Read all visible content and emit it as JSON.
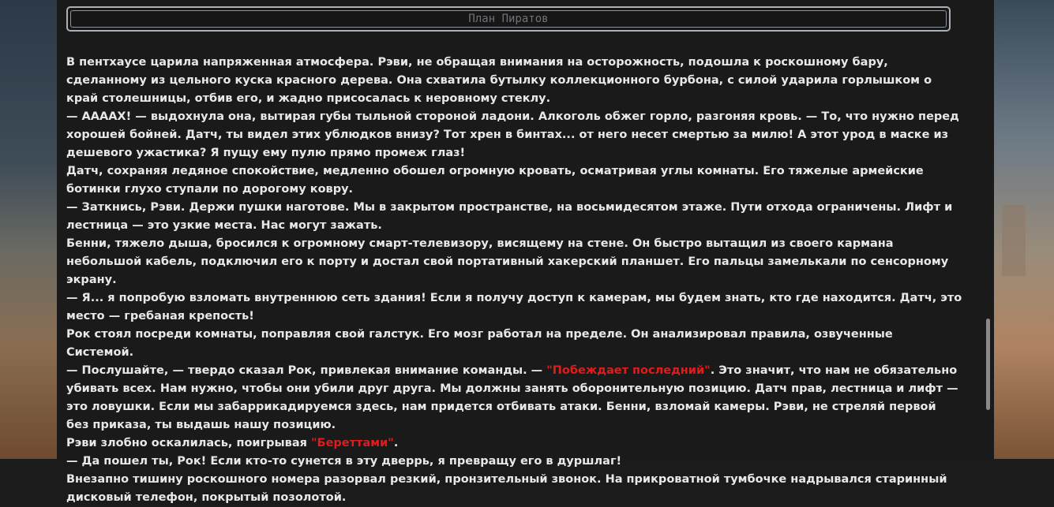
{
  "title": "План Пиратов",
  "paragraphs": [
    {
      "segments": [
        {
          "text": "В пентхаусе царила напряженная атмосфера. Рэви, не обращая внимания на осторожность, подошла к роскошному бару, сделанному из цельного куска красного дерева. Она схватила бутылку коллекционного бурбона, с силой ударила горлышком о край столешницы, отбив его, и жадно присосалась к неровному стеклу.",
          "hl": false
        }
      ]
    },
    {
      "segments": [
        {
          "text": "— ААААХ! — выдохнула она, вытирая губы тыльной стороной ладони. Алкоголь обжег горло, разгоняя кровь. — То, что нужно перед хорошей бойней. Датч, ты видел этих ублюдков внизу? Тот хрен в бинтах... от него несет смертью за милю! А этот урод в маске из дешевого ужастика? Я пущу ему пулю прямо промеж глаз!",
          "hl": false
        }
      ]
    },
    {
      "segments": [
        {
          "text": "Датч, сохраняя ледяное спокойствие, медленно обошел огромную кровать, осматривая углы комнаты. Его тяжелые армейские ботинки глухо ступали по дорогому ковру.",
          "hl": false
        }
      ]
    },
    {
      "segments": [
        {
          "text": "— Заткнись, Рэви. Держи пушки наготове. Мы в закрытом пространстве, на восьмидесятом этаже. Пути отхода ограничены. Лифт и лестница — это узкие места. Нас могут зажать.",
          "hl": false
        }
      ]
    },
    {
      "segments": [
        {
          "text": "Бенни, тяжело дыша, бросился к огромному смарт-телевизору, висящему на стене. Он быстро вытащил из своего кармана небольшой кабель, подключил его к порту и достал свой портативный хакерский планшет. Его пальцы замелькали по сенсорному экрану.",
          "hl": false
        }
      ]
    },
    {
      "segments": [
        {
          "text": "— Я... я попробую взломать внутреннюю сеть здания! Если я получу доступ к камерам, мы будем знать, кто где находится. Датч, это место — гребаная крепость!",
          "hl": false
        }
      ]
    },
    {
      "segments": [
        {
          "text": "Рок стоял посреди комнаты, поправляя свой галстук. Его мозг работал на пределе. Он анализировал правила, озвученные Системой.",
          "hl": false
        }
      ]
    },
    {
      "segments": [
        {
          "text": "— Послушайте, — твердо сказал Рок, привлекая внимание команды. — ",
          "hl": false
        },
        {
          "text": "\"Побеждает последний\"",
          "hl": true
        },
        {
          "text": ". Это значит, что нам не обязательно убивать всех. Нам нужно, чтобы они убили друг друга. Мы должны занять оборонительную позицию. Датч прав, лестница и лифт — это ловушки. Если мы забаррикадируемся здесь, нам придется отбивать атаки. Бенни, взломай камеры. Рэви, не стреляй первой без приказа, ты выдашь нашу позицию.",
          "hl": false
        }
      ]
    },
    {
      "segments": [
        {
          "text": "Рэви злобно оскалилась, поигрывая ",
          "hl": false
        },
        {
          "text": "\"Береттами\"",
          "hl": true
        },
        {
          "text": ".",
          "hl": false
        }
      ]
    },
    {
      "segments": [
        {
          "text": "— Да пошел ты, Рок! Если кто-то сунется в эту дверрь, я превращу его в дуршлаг!",
          "hl": false
        }
      ]
    },
    {
      "segments": [
        {
          "text": "Внезапно тишину роскошного номера разорвал резкий, пронзительный звонок. На прикроватной тумбочке надрывался старинный дисковый телефон, покрытый позолотой.",
          "hl": false
        }
      ]
    }
  ]
}
